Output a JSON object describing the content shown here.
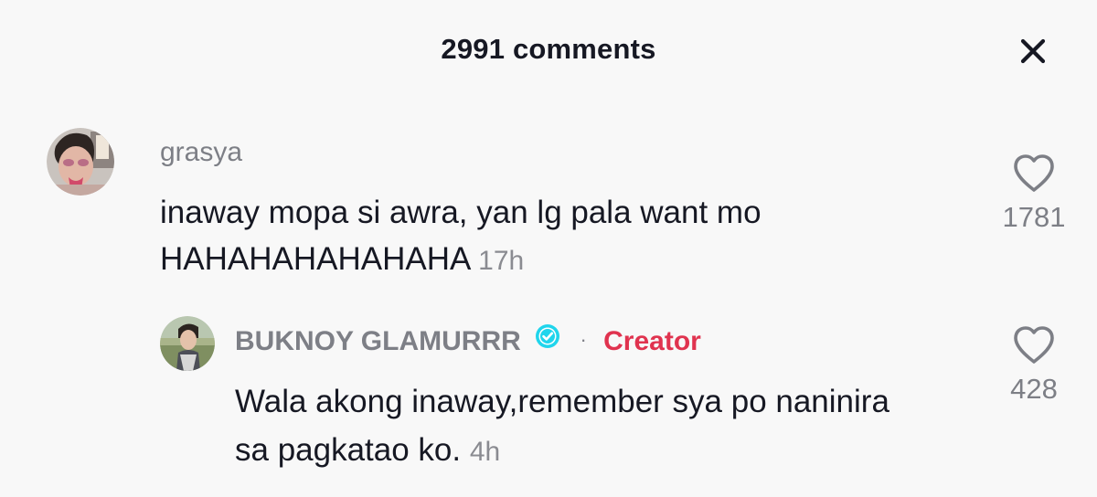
{
  "header": {
    "title": "2991 comments",
    "close_icon": "close-icon"
  },
  "comments": [
    {
      "username": "grasya",
      "text": "inaway mopa si awra, yan lg pala want mo HAHAHAHAHAHAHA",
      "time": "17h",
      "likes": "1781",
      "avatar_icon": "avatar-photo"
    }
  ],
  "replies": [
    {
      "username": "BUKNOY GLAMURRR",
      "verified_icon": "verified-badge-icon",
      "separator": "·",
      "badge": "Creator",
      "text": "Wala akong inaway,remember sya po naninira sa pagkatao ko.",
      "time": "4h",
      "likes": "428",
      "avatar_icon": "avatar-photo"
    }
  ],
  "colors": {
    "background": "#f8f8f8",
    "text": "#161823",
    "muted": "#7d7f86",
    "creator": "#e0334f",
    "verified": "#20d5ec"
  }
}
